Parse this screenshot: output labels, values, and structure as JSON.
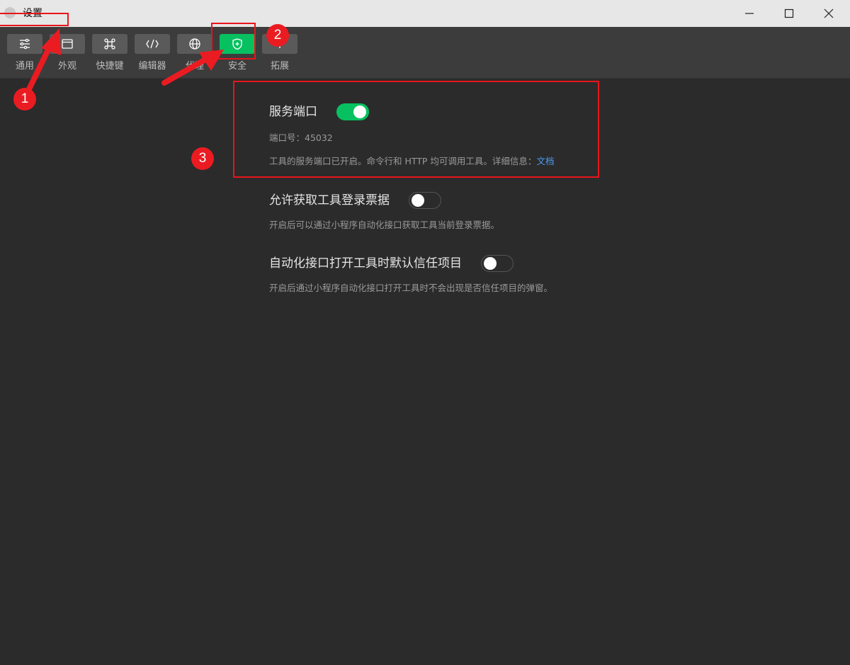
{
  "window": {
    "title": "设置"
  },
  "toolbar": {
    "tabs": [
      {
        "label": "通用",
        "icon": "sliders-icon"
      },
      {
        "label": "外观",
        "icon": "window-icon"
      },
      {
        "label": "快捷键",
        "icon": "command-icon"
      },
      {
        "label": "编辑器",
        "icon": "code-icon"
      },
      {
        "label": "代理",
        "icon": "globe-icon"
      },
      {
        "label": "安全",
        "icon": "shield-icon",
        "active": true
      },
      {
        "label": "拓展",
        "icon": "plus-icon"
      }
    ],
    "active_color": "#07c160"
  },
  "settings": {
    "service_port": {
      "title": "服务端口",
      "enabled": true,
      "port_line": "端口号：45032",
      "desc": "工具的服务端口已开启。命令行和 HTTP 均可调用工具。详细信息：",
      "link": "文档"
    },
    "login_ticket": {
      "title": "允许获取工具登录票据",
      "enabled": false,
      "desc": "开启后可以通过小程序自动化接口获取工具当前登录票据。"
    },
    "trust_project": {
      "title": "自动化接口打开工具时默认信任项目",
      "enabled": false,
      "desc": "开启后通过小程序自动化接口打开工具时不会出现是否信任项目的弹窗。"
    }
  },
  "annotations": {
    "badges": [
      "1",
      "2",
      "3"
    ],
    "color": "#e8151b"
  }
}
